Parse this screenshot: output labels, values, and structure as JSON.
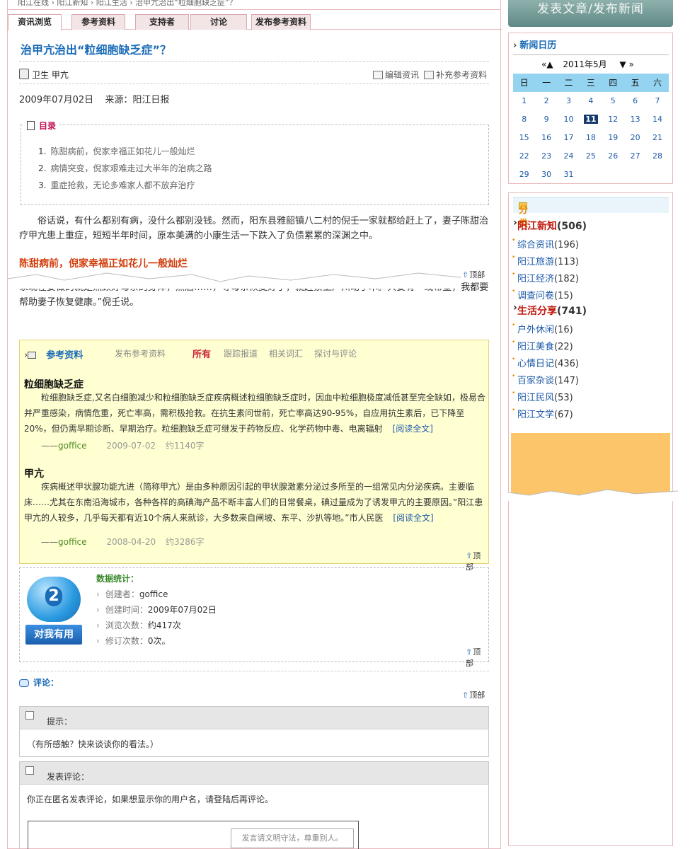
{
  "top_strip": "阳江在线 › 阳江新知 › 阳江生活 › 治甲亢治出“粒细胞缺乏症”？",
  "tabs": [
    "资讯浏览",
    "参考资料",
    "支持者",
    "讨论",
    "发布参考资料"
  ],
  "article": {
    "title": "治甲亢治出“粒细胞缺乏症”？",
    "tags": "卫生  甲亢",
    "actions": [
      "编辑资讯",
      "补充参考资料"
    ],
    "date": "2009年07月02日",
    "source_label": "来源：",
    "source": "阳江日报",
    "toc_title": "目录",
    "toc": [
      "陈甜病前，倪家幸福正如花儿一般灿烂",
      "病情突变，倪家艰难走过大半年的治病之路",
      "重症抢救，无论多难家人都不放弃治疗"
    ],
    "intro": "俗话说，有什么都别有病，没什么都别没钱。然而，阳东县雅韶镇八二村的倪壬一家就都给赶上了，妻子陈甜治疗甲亢患上重症，短短半年时间，原本美满的小康生活一下跌入了负债累累的深渊之中。",
    "section1_title": "陈甜病前，倪家幸福正如花儿一般灿烂",
    "section1_text": "家现在要做的就是照顾好母亲的身体，然后……，等母亲恢复好了，就赶紧上广州动手术。”只要有一线希望，我都要帮助妻子恢复健康。”倪壬说。",
    "to_top": "顶部"
  },
  "references": {
    "title": "参考资料",
    "tabs": [
      "发布参考资料",
      "所有",
      "跟踪报道",
      "相关词汇",
      "探讨与评论"
    ],
    "entries": [
      {
        "title": "粒细胞缺乏症",
        "body": "粒细胞缺乏症,又名白细胞减少和粒细胞缺乏症疾病概述粒细胞缺乏症时，因血中粒细胞极度减低甚至完全缺如，极易合并严重感染，病情危重，死亡率高，需积极抢救。在抗生素问世前，死亡率高达90-95%，自应用抗生素后，已下降至20%，但仍需早期诊断、早期治疗。粒细胞缺乏症可继发于药物反应、化学药物中毒、电离辐射",
        "read": "[阅读全文]",
        "author_prefix": "——",
        "author": "goffice",
        "date": "2009-07-02",
        "size": "约1140字"
      },
      {
        "title": "甲亢",
        "body": "疾病概述甲状腺功能亢进（简称甲亢）是由多种原因引起的甲状腺激素分泌过多所至的一组常见内分泌疾病。主要临床……尤其在东南沿海城市，各种各样的高碘海产品不断丰富人们的日常餐桌，碘过量成为了诱发甲亢的主要原因。”阳江患甲亢的人较多，几乎每天都有近10个病人来就诊，大多数来自闸坡、东平、沙扒等地。”市人民医",
        "read": "[阅读全文]",
        "author_prefix": "——",
        "author": "goffice",
        "date": "2008-04-20",
        "size": "约3286字"
      }
    ]
  },
  "stats": {
    "badge_number": "2",
    "badge_button": "对我有用",
    "title": "数据统计：",
    "rows": [
      {
        "label": "创建者：",
        "value": "goffice"
      },
      {
        "label": "创建时间：",
        "value": "2009年07月02日"
      },
      {
        "label": "浏览次数：",
        "value": "约417次"
      },
      {
        "label": "修订次数：",
        "value": "0次。"
      }
    ]
  },
  "comments": {
    "title": "评论：",
    "hint_title": "提示：",
    "hint_text": "（有所感触？快来谈谈你的看法。）",
    "post_title": "发表评论：",
    "post_text": "你正在匿名发表评论，如果想显示你的用户名，请登陆后再评论。",
    "editor_placeholder": "发言请文明守法，尊重别人。"
  },
  "sidebar": {
    "publish_button": "发表文章/发布新闻",
    "calendar": {
      "title": "新闻日历",
      "prev": "«▲",
      "month": "2011年5月",
      "next": "▼ »",
      "weekdays": [
        "日",
        "一",
        "二",
        "三",
        "四",
        "五",
        "六"
      ],
      "weeks": [
        [
          "1",
          "2",
          "3",
          "4",
          "5",
          "6",
          "7"
        ],
        [
          "8",
          "9",
          "10",
          "11",
          "12",
          "13",
          "14"
        ],
        [
          "15",
          "16",
          "17",
          "18",
          "19",
          "20",
          "21"
        ],
        [
          "22",
          "23",
          "24",
          "25",
          "26",
          "27",
          "28"
        ],
        [
          "29",
          "30",
          "31",
          "",
          "",
          "",
          ""
        ]
      ],
      "today": "11"
    },
    "categories": {
      "title": "分类",
      "groups": [
        {
          "name": "阳江新知",
          "count": "(506)",
          "items": [
            {
              "name": "综合资讯",
              "count": "(196)"
            },
            {
              "name": "阳江旅游",
              "count": "(113)"
            },
            {
              "name": "阳江经济",
              "count": "(182)"
            },
            {
              "name": "调查问卷",
              "count": "(15)"
            }
          ]
        },
        {
          "name": "生活分享",
          "count": "(741)",
          "items": [
            {
              "name": "户外休闲",
              "count": "(16)"
            },
            {
              "name": "阳江美食",
              "count": "(22)"
            },
            {
              "name": "心情日记",
              "count": "(436)"
            },
            {
              "name": "百家杂谈",
              "count": "(147)"
            },
            {
              "name": "阳江民风",
              "count": "(53)"
            },
            {
              "name": "阳江文学",
              "count": "(67)"
            }
          ]
        }
      ]
    }
  }
}
